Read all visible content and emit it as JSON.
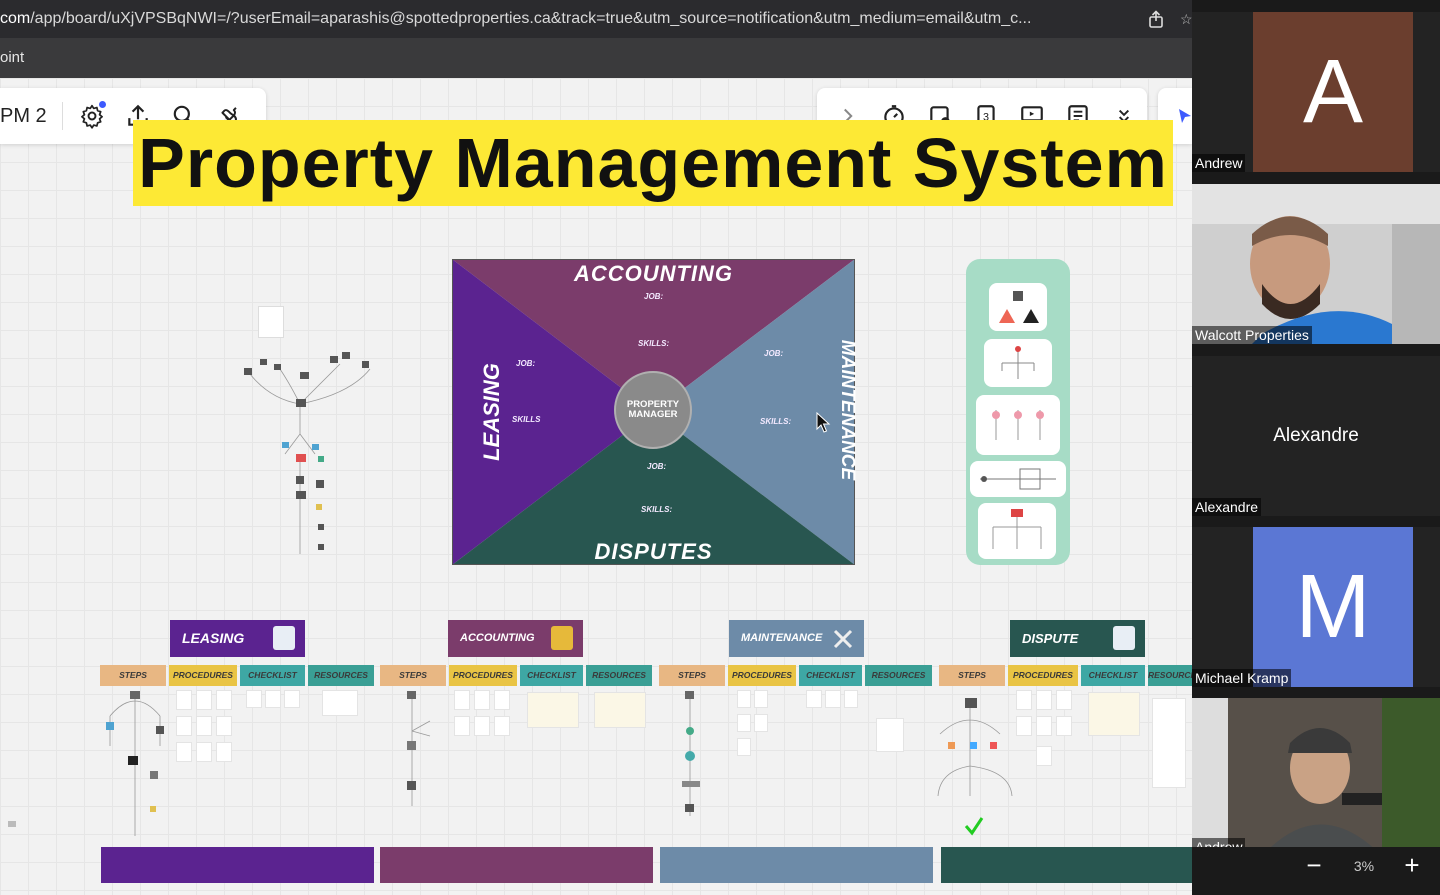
{
  "browser": {
    "url_host": "com",
    "url_path": "/app/board/uXjVPSBqNWI=/?userEmail=aparashis@spottedproperties.ca&track=true&utm_source=notification&utm_medium=email&utm_c...",
    "bookmark_label": "oint"
  },
  "board": {
    "name": "PM 2",
    "title": "Property Management System"
  },
  "diagram": {
    "top_label": "Accounting",
    "bottom_label": "Disputes",
    "left_label": "Leasing",
    "right_label": "Maintenance",
    "center_label": "PROPERTY MANAGER",
    "job_label": "JOB:",
    "skills_label": "SKILLS:",
    "skills_label_left": "SKILLS",
    "colors": {
      "accounting": "#7b3c6b",
      "leasing": "#5b2390",
      "maintenance": "#6d8ba8",
      "disputes": "#285650",
      "center": "#8a8a8a"
    }
  },
  "categories": [
    {
      "label": "Leasing",
      "color": "#5b2390",
      "icon": "document-icon"
    },
    {
      "label": "Accounting",
      "color": "#7b3c6b",
      "icon": "calculator-icon"
    },
    {
      "label": "Maintenance",
      "color": "#6d8ba8",
      "icon": "tools-icon"
    },
    {
      "label": "Dispute",
      "color": "#285650",
      "icon": "paper-icon"
    }
  ],
  "columns": [
    "Steps",
    "Procedures",
    "Checklist",
    "Resources"
  ],
  "participants": [
    {
      "name": "Andrew",
      "initial": "A",
      "type": "avatar",
      "color": "#6b3e2e"
    },
    {
      "name": "Walcott Properties",
      "type": "video"
    },
    {
      "name": "Alexandre",
      "type": "name-only",
      "display": "Alexandre"
    },
    {
      "name": "Michael Kramp",
      "initial": "M",
      "type": "avatar",
      "color": "#5b77d4"
    },
    {
      "name": "Andrew",
      "type": "video"
    }
  ],
  "zoom": {
    "minus": "−",
    "value": "3%",
    "plus": "+"
  }
}
